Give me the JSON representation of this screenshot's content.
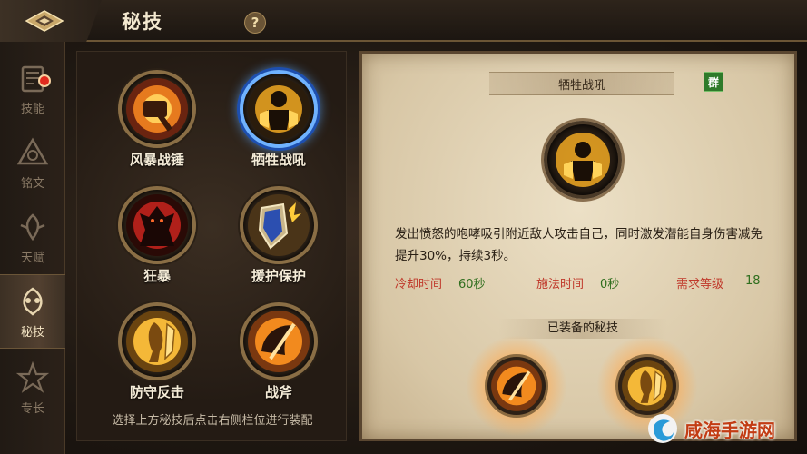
{
  "header": {
    "title": "秘技",
    "help": "?"
  },
  "sidebar": {
    "items": [
      {
        "label": "技能",
        "icon": "skill-book-icon",
        "badge": true
      },
      {
        "label": "铭文",
        "icon": "rune-triangle-icon"
      },
      {
        "label": "天赋",
        "icon": "talent-icon"
      },
      {
        "label": "秘技",
        "icon": "secret-skill-icon",
        "active": true
      },
      {
        "label": "专长",
        "icon": "specialty-icon"
      }
    ]
  },
  "skills": [
    {
      "name": "风暴战锤",
      "icon": "hammer-icon"
    },
    {
      "name": "牺牲战吼",
      "icon": "warcry-icon",
      "selected": true
    },
    {
      "name": "狂暴",
      "icon": "berserk-icon"
    },
    {
      "name": "援护保护",
      "icon": "shield-icon"
    },
    {
      "name": "防守反击",
      "icon": "counter-icon"
    },
    {
      "name": "战斧",
      "icon": "axe-icon"
    }
  ],
  "hint": "选择上方秘技后点击右侧栏位进行装配",
  "detail": {
    "title": "牺牲战吼",
    "badge": "群",
    "description": "发出愤怒的咆哮吸引附近敌人攻击自己，同时激发潜能自身伤害减免提升30%，持续3秒。",
    "stats": {
      "cooldown_label": "冷却时间",
      "cooldown_value": "60秒",
      "cast_label": "施法时间",
      "cast_value": "0秒",
      "level_label": "需求等级",
      "level_value": "18"
    },
    "equipped_title": "已装备的秘技",
    "equipped": [
      {
        "icon": "axe-icon"
      },
      {
        "icon": "counter-icon"
      }
    ]
  },
  "watermark": "咸海手游网",
  "colors": {
    "accent_gold": "#8a6e45",
    "selected_blue": "#6fb2ff",
    "stat_label_red": "#c0392b",
    "stat_value_green": "#2f6e1e"
  }
}
